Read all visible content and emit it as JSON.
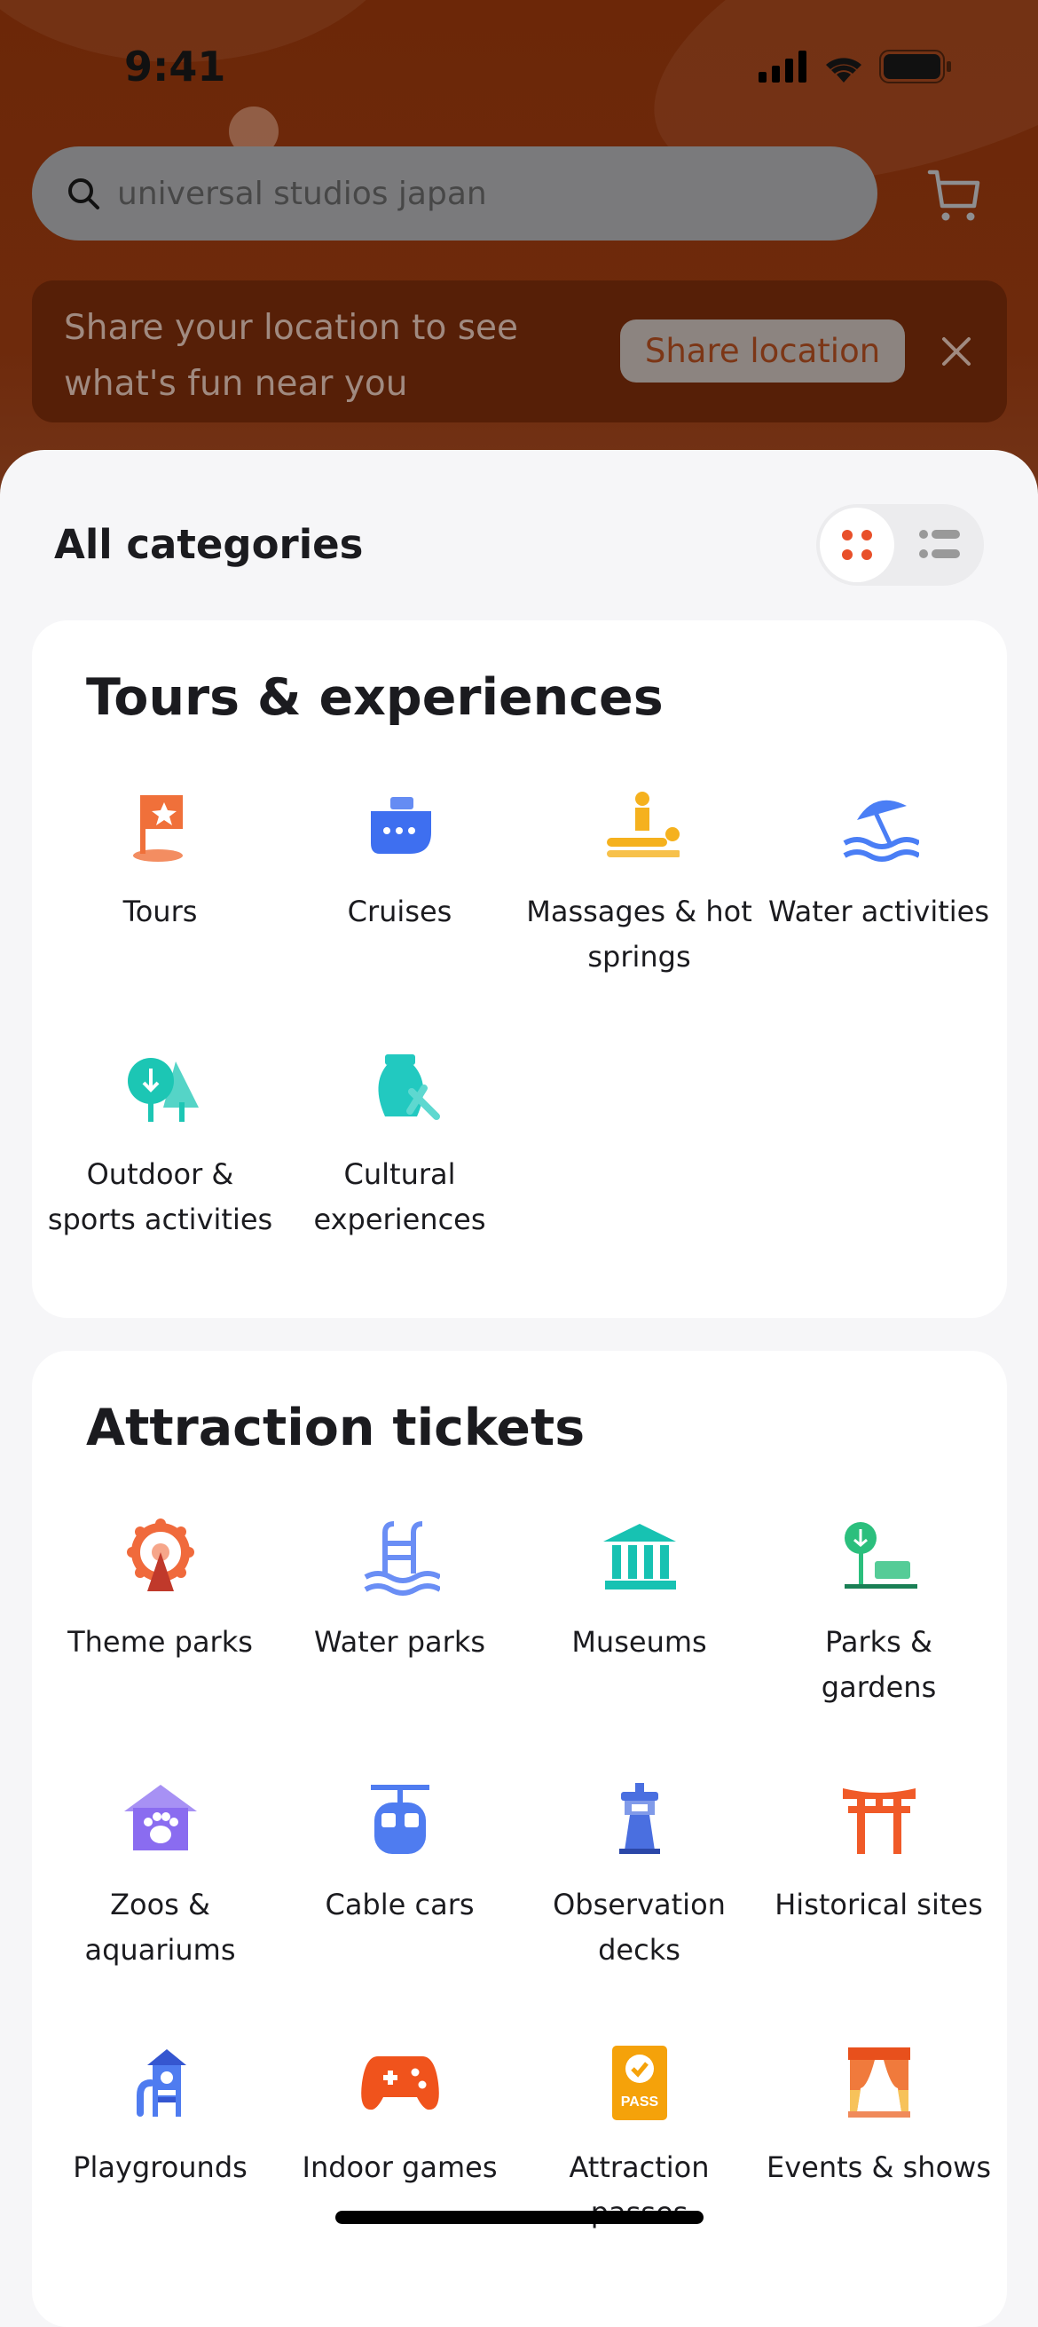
{
  "status_bar": {
    "time": "9:41"
  },
  "search": {
    "value": "universal studios japan"
  },
  "location_banner": {
    "message": "Share your location to see what's fun near you",
    "button_label": "Share location"
  },
  "sheet": {
    "title": "All categories",
    "view_mode": "grid"
  },
  "colors": {
    "accent": "#e8502a",
    "header_bg": "#6e2a0c"
  },
  "sections": [
    {
      "title": "Tours & experiences",
      "items": [
        {
          "label": "Tours",
          "icon": "flag-icon",
          "color": "#f0703a"
        },
        {
          "label": "Cruises",
          "icon": "ship-icon",
          "color": "#3e6ff0"
        },
        {
          "label": "Massages & hot springs",
          "icon": "massage-icon",
          "color": "#f5b11e"
        },
        {
          "label": "Water activities",
          "icon": "beach-umbrella-icon",
          "color": "#4a7ef5"
        },
        {
          "label": "Outdoor & sports activities",
          "icon": "trees-icon",
          "color": "#1cc6b4"
        },
        {
          "label": "Cultural experiences",
          "icon": "pottery-tools-icon",
          "color": "#22c9c0"
        }
      ]
    },
    {
      "title": "Attraction tickets",
      "items": [
        {
          "label": "Theme parks",
          "icon": "ferris-wheel-icon",
          "color": "#f06a3c"
        },
        {
          "label": "Water parks",
          "icon": "pool-ladder-icon",
          "color": "#6a8ef5"
        },
        {
          "label": "Museums",
          "icon": "museum-icon",
          "color": "#17c2b2"
        },
        {
          "label": "Parks & gardens",
          "icon": "park-bench-icon",
          "color": "#2bbf7d"
        },
        {
          "label": "Zoos & aquariums",
          "icon": "paw-house-icon",
          "color": "#8a6cf0"
        },
        {
          "label": "Cable cars",
          "icon": "cable-car-icon",
          "color": "#4f7cf0"
        },
        {
          "label": "Observation decks",
          "icon": "tower-icon",
          "color": "#4a6fe0"
        },
        {
          "label": "Historical sites",
          "icon": "torii-gate-icon",
          "color": "#f05a28"
        },
        {
          "label": "Playgrounds",
          "icon": "playground-icon",
          "color": "#4f7cf0"
        },
        {
          "label": "Indoor games",
          "icon": "gamepad-icon",
          "color": "#f0531c"
        },
        {
          "label": "Attraction passes",
          "icon": "pass-icon",
          "color": "#f5a20a",
          "icon_text": "PASS"
        },
        {
          "label": "Events & shows",
          "icon": "stage-curtain-icon",
          "color": "#f07a3c"
        }
      ]
    }
  ]
}
